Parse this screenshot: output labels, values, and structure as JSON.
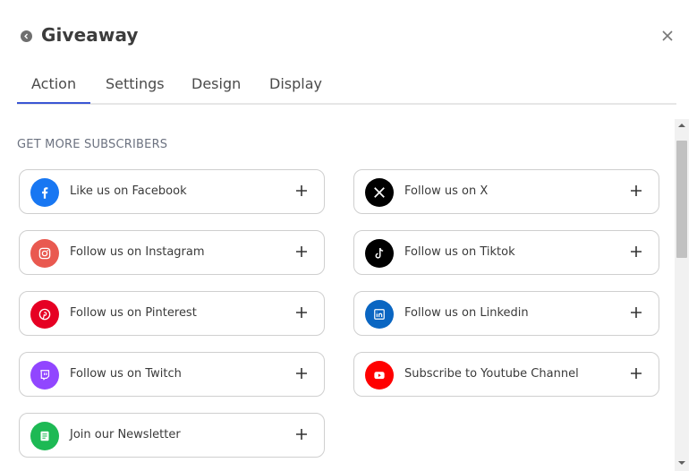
{
  "header": {
    "title": "Giveaway"
  },
  "tabs": [
    {
      "label": "Action",
      "active": true
    },
    {
      "label": "Settings",
      "active": false
    },
    {
      "label": "Design",
      "active": false
    },
    {
      "label": "Display",
      "active": false
    }
  ],
  "section": {
    "title": "GET MORE SUBSCRIBERS"
  },
  "actions": [
    {
      "label": "Like us on Facebook",
      "icon": "facebook-icon",
      "color": "#1877f2"
    },
    {
      "label": "Follow us on X",
      "icon": "x-icon",
      "color": "#000000"
    },
    {
      "label": "Follow us on Instagram",
      "icon": "instagram-icon",
      "color": "#e95950"
    },
    {
      "label": "Follow us on Tiktok",
      "icon": "tiktok-icon",
      "color": "#000000"
    },
    {
      "label": "Follow us on Pinterest",
      "icon": "pinterest-icon",
      "color": "#e60023"
    },
    {
      "label": "Follow us on Linkedin",
      "icon": "linkedin-icon",
      "color": "#0a66c2"
    },
    {
      "label": "Follow us on Twitch",
      "icon": "twitch-icon",
      "color": "#9146ff"
    },
    {
      "label": "Subscribe to Youtube Channel",
      "icon": "youtube-icon",
      "color": "#ff0000"
    },
    {
      "label": "Join our Newsletter",
      "icon": "newsletter-icon",
      "color": "#1db954"
    }
  ],
  "colors": {
    "accent": "#3b56d4",
    "border": "#cfcfcf",
    "muted_text": "#6c7280"
  }
}
